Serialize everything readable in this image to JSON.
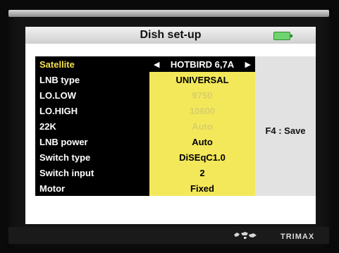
{
  "window": {
    "title": "Dish set-up"
  },
  "settings": {
    "rows": [
      {
        "label": "Satellite",
        "value": "HOTBIRD 6,7A",
        "selected": true
      },
      {
        "label": "LNB type",
        "value": "UNIVERSAL"
      },
      {
        "label": "LO.LOW",
        "value": "9750",
        "disabled": true
      },
      {
        "label": "LO.HIGH",
        "value": "10600",
        "disabled": true
      },
      {
        "label": "22K",
        "value": "Auto",
        "disabled": true
      },
      {
        "label": "LNB power",
        "value": "Auto"
      },
      {
        "label": "Switch type",
        "value": "DiSEqC1.0"
      },
      {
        "label": "Switch input",
        "value": "2"
      },
      {
        "label": "Motor",
        "value": "Fixed"
      }
    ]
  },
  "hint": {
    "save": "F4 : Save"
  },
  "footer": {
    "brand": "TRIMAX"
  },
  "icons": {
    "left": "triangle-left-icon",
    "right": "triangle-right-icon",
    "battery": "battery-icon",
    "map": "world-map-icon"
  },
  "colors": {
    "highlight": "#f3e85a",
    "selected_text": "#f5e14f",
    "panel": "#ffffff",
    "menu_bg": "#000000"
  }
}
